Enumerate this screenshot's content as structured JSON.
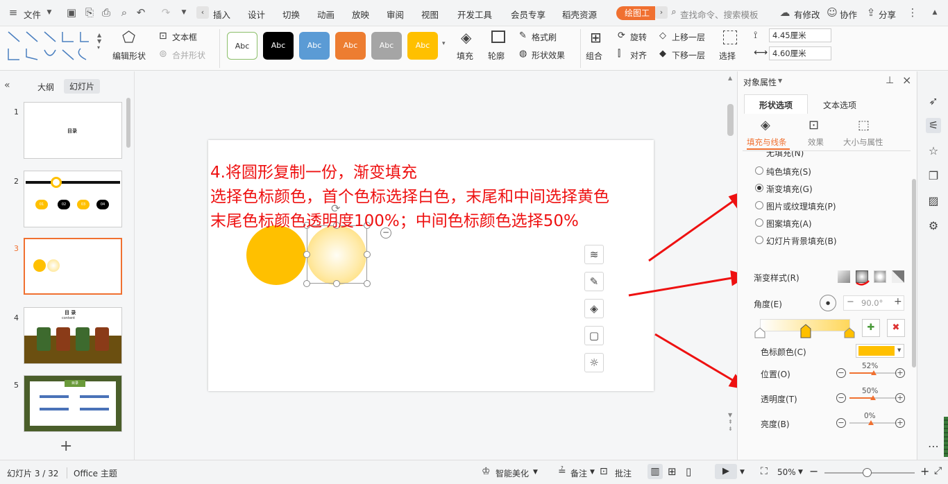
{
  "menubar": {
    "file": "文件",
    "tabs": [
      "插入",
      "设计",
      "切换",
      "动画",
      "放映",
      "审阅",
      "视图",
      "开发工具",
      "会员专享",
      "稻壳资源"
    ],
    "active_tab": "绘图工",
    "search": "查找命令、搜索模板",
    "modified": "有修改",
    "collab": "协作",
    "share": "分享"
  },
  "ribbon": {
    "edit_shape": "编辑形状",
    "textbox": "文本框",
    "merge_shape": "合并形状",
    "style_label": "Abc",
    "fill": "填充",
    "outline": "轮廓",
    "format_brush": "格式刷",
    "shape_effect": "形状效果",
    "group": "组合",
    "rotate": "旋转",
    "align": "对齐",
    "bring_forward": "上移一层",
    "send_backward": "下移一层",
    "select": "选择",
    "height": "4.45厘米",
    "width": "4.60厘米"
  },
  "leftpane": {
    "tab_outline": "大纲",
    "tab_slides": "幻灯片",
    "slides": [
      "1",
      "2",
      "3",
      "4",
      "5"
    ],
    "slide1_title": "目录",
    "slide4_title": "目 录",
    "slide4_sub": "content",
    "slide5_banner": "目录",
    "slide2_labels": [
      "01",
      "02",
      "03",
      "04"
    ]
  },
  "canvas": {
    "line1": "4.将圆形复制一份，渐变填充",
    "line2": "选择色标颜色，首个色标选择白色，末尾和中间选择黄色",
    "line3": "末尾色标颜色透明度100%；中间色标颜色选择50%"
  },
  "rightpane": {
    "title": "对象属性",
    "tab_shape": "形状选项",
    "tab_text": "文本选项",
    "sub_fill_line": "填充与线条",
    "sub_effect": "效果",
    "sub_size": "大小与属性",
    "fill_none": "无填充(N)",
    "fill_solid": "纯色填充(S)",
    "fill_gradient": "渐变填充(G)",
    "fill_picture": "图片或纹理填充(P)",
    "fill_pattern": "图案填充(A)",
    "fill_bg": "幻灯片背景填充(B)",
    "gradient_style": "渐变样式(R)",
    "angle": "角度(E)",
    "angle_value": "90.0°",
    "stop_color": "色标颜色(C)",
    "position": "位置(O)",
    "position_value": "52%",
    "transparency": "透明度(T)",
    "transparency_value": "50%",
    "brightness": "亮度(B)",
    "brightness_value": "0%"
  },
  "statusbar": {
    "slide_info": "幻灯片 3 / 32",
    "theme": "Office 主题",
    "beautify": "智能美化",
    "notes": "备注",
    "comment": "批注",
    "zoom": "50%"
  },
  "colors": {
    "accent": "#f07030",
    "yellow": "#ffc000",
    "red_text": "#ee1111"
  },
  "levels": {
    "position": 0.52,
    "transparency": 0.5,
    "brightness": 0.0,
    "zoom": 0.5
  }
}
